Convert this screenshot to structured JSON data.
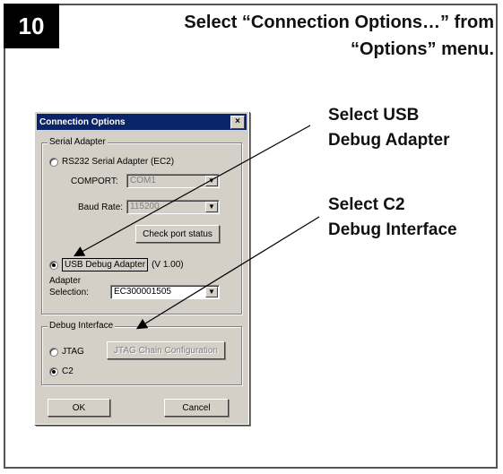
{
  "step": {
    "number": "10"
  },
  "instruction": {
    "line1": "Select “Connection Options…” from",
    "line2": "“Options” menu."
  },
  "callouts": {
    "usb": {
      "line1": "Select USB",
      "line2": "Debug Adapter"
    },
    "c2": {
      "line1": "Select C2",
      "line2": "Debug Interface"
    }
  },
  "dialog": {
    "title": "Connection Options",
    "close_label": "×",
    "serial_adapter": {
      "legend": "Serial Adapter",
      "rs232_label": "RS232 Serial Adapter (EC2)",
      "comport_label": "COMPORT:",
      "comport_value": "COM1",
      "baud_label": "Baud Rate:",
      "baud_value": "115200",
      "check_port_label": "Check port status",
      "usb_label": "USB Debug Adapter",
      "usb_version": "(V 1.00)",
      "adapter_label_1": "Adapter",
      "adapter_label_2": "Selection:",
      "adapter_value": "EC300001505"
    },
    "debug_interface": {
      "legend": "Debug Interface",
      "jtag_label": "JTAG",
      "jtag_chain_label": "JTAG Chain Configuration",
      "c2_label": "C2"
    },
    "ok_label": "OK",
    "cancel_label": "Cancel"
  },
  "colors": {
    "titlebar": "#0a246a",
    "dialog_bg": "#d4d0c8",
    "step_badge": "#000000"
  },
  "icons": [
    "close-icon",
    "dropdown-arrow-icon",
    "radio-icon",
    "arrow-icon"
  ]
}
